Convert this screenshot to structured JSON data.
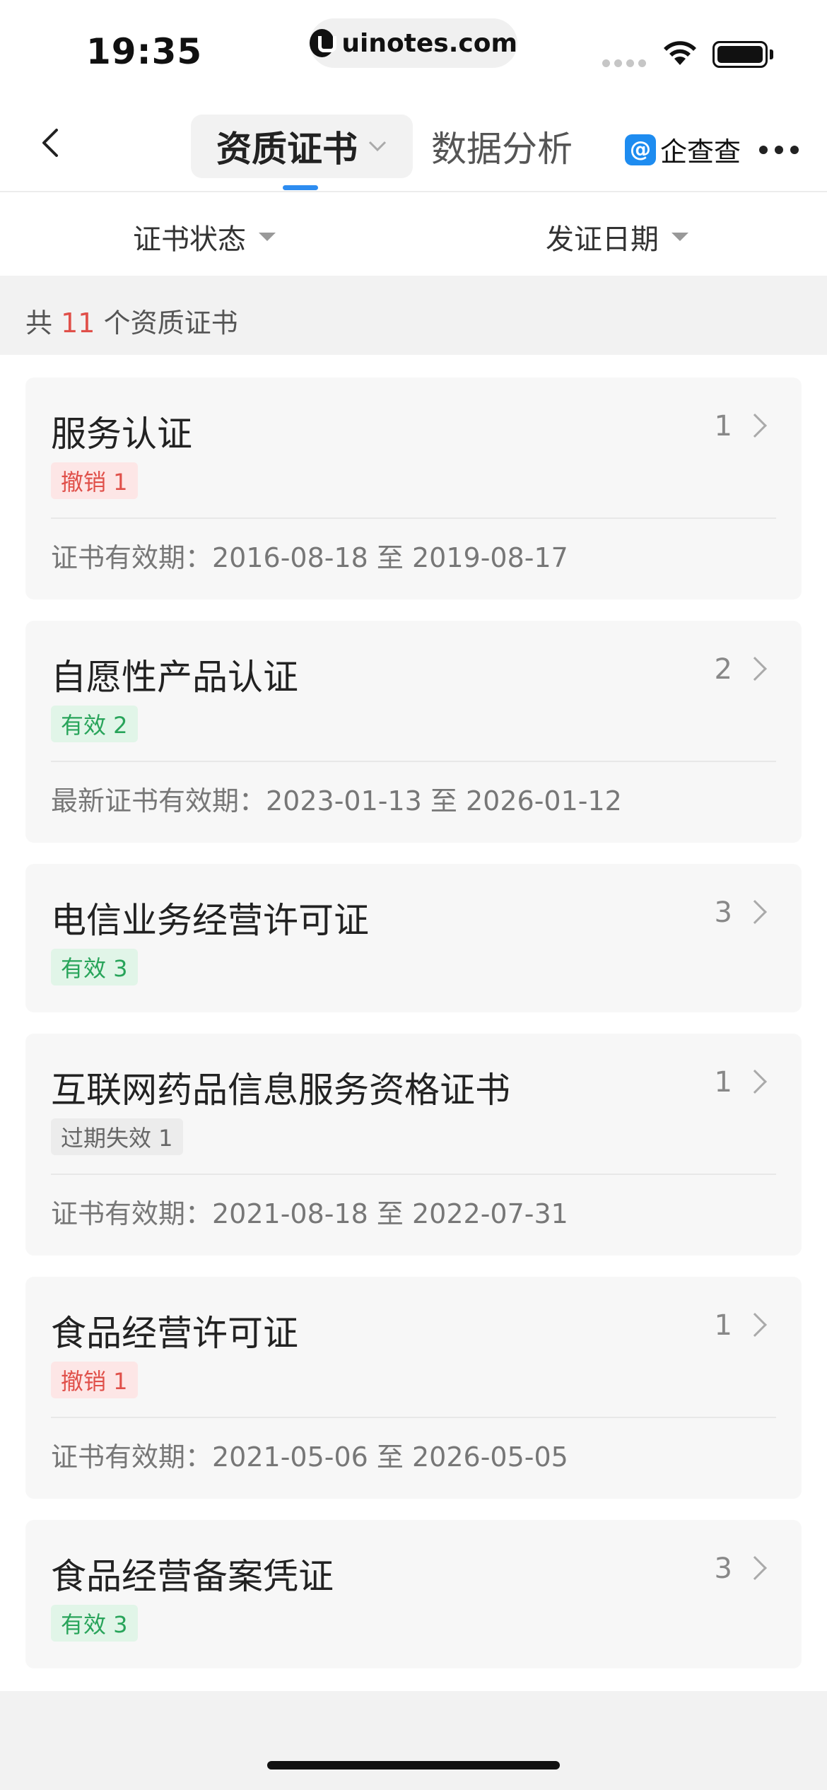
{
  "status_bar": {
    "time": "19:35",
    "url": "uinotes.com"
  },
  "nav": {
    "tab_active": "资质证书",
    "tab_2": "数据分析",
    "brand": "企查查",
    "brand_icon": "qichacha-logo"
  },
  "filters": {
    "status": "证书状态",
    "date": "发证日期"
  },
  "count": {
    "prefix": "共",
    "number": "11",
    "suffix": "个资质证书"
  },
  "cards": [
    {
      "title": "服务认证",
      "count": "1",
      "badge": "撤销 1",
      "badge_type": "red",
      "validity": "证书有效期：2016-08-18 至 2019-08-17"
    },
    {
      "title": "自愿性产品认证",
      "count": "2",
      "badge": "有效 2",
      "badge_type": "green",
      "validity": "最新证书有效期：2023-01-13 至 2026-01-12"
    },
    {
      "title": "电信业务经营许可证",
      "count": "3",
      "badge": "有效 3",
      "badge_type": "green",
      "validity": ""
    },
    {
      "title": "互联网药品信息服务资格证书",
      "count": "1",
      "badge": "过期失效 1",
      "badge_type": "gray",
      "validity": "证书有效期：2021-08-18 至 2022-07-31"
    },
    {
      "title": "食品经营许可证",
      "count": "1",
      "badge": "撤销 1",
      "badge_type": "red",
      "validity": "证书有效期：2021-05-06 至 2026-05-05"
    },
    {
      "title": "食品经营备案凭证",
      "count": "3",
      "badge": "有效 3",
      "badge_type": "green",
      "validity": ""
    }
  ],
  "colors": {
    "accent": "#2d8cf0",
    "red": "#e0504a",
    "green": "#28a45a"
  }
}
